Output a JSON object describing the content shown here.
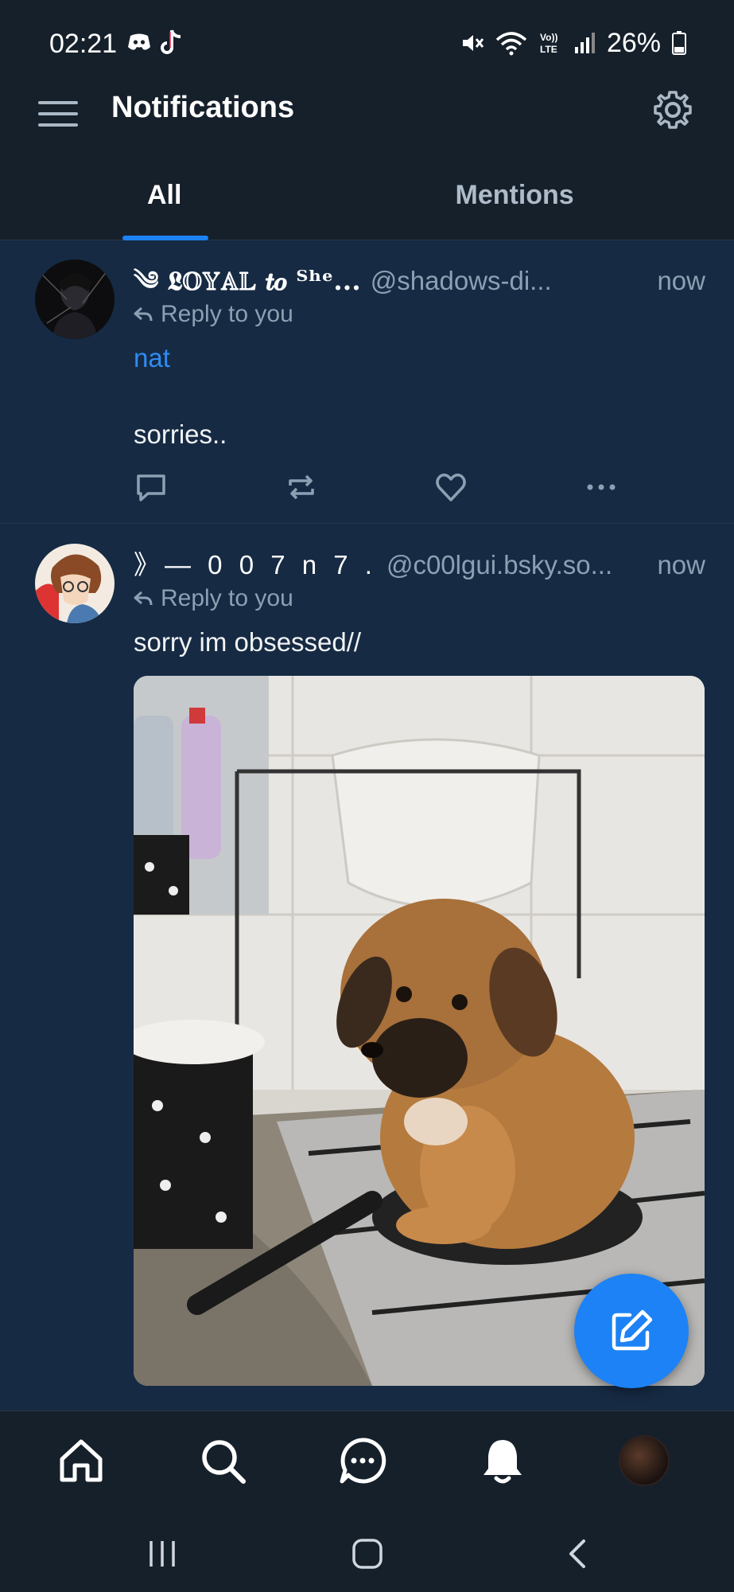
{
  "status_bar": {
    "time": "02:21",
    "battery_text": "26%",
    "icons": [
      "discord-icon",
      "tiktok-icon",
      "mute-icon",
      "wifi-icon",
      "volte-icon",
      "signal-icon",
      "battery-icon"
    ],
    "volte_label": "Vo))\nLTE"
  },
  "header": {
    "title": "Notifications"
  },
  "tabs": [
    {
      "label": "All",
      "active": true
    },
    {
      "label": "Mentions",
      "active": false
    }
  ],
  "notifications": [
    {
      "display_name": "༄ 𝕷𝕆𝕐𝔸𝕃 𝒕𝒐 ᵀʰᵉ...",
      "handle": "@shadows-di...",
      "time": "now",
      "reply_label": "Reply to you",
      "mention": "nat",
      "text": "sorries.."
    },
    {
      "display_name": "》— 0 0 7 n 7 .",
      "handle": "@c00lgui.bsky.so...",
      "time": "now",
      "reply_label": "Reply to you",
      "text": "sorry im obsessed//",
      "image_alt": "puppy sitting in a frying pan on a stove"
    }
  ],
  "colors": {
    "accent": "#1d82f5",
    "background": "#16202b",
    "feed_background": "#162a43",
    "muted_text": "#8da0b3"
  },
  "bottom_nav": [
    "home-icon",
    "search-icon",
    "chat-icon",
    "bell-icon",
    "profile-avatar"
  ],
  "system_nav": [
    "recents-button",
    "home-button",
    "back-button"
  ]
}
